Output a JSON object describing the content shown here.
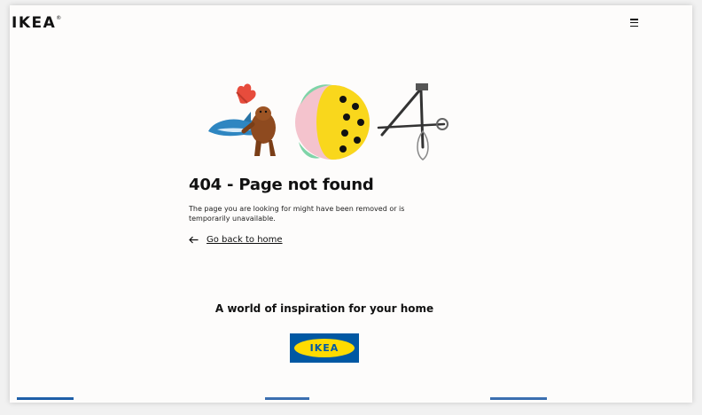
{
  "brand": {
    "name": "IKEA",
    "registered_mark": "®"
  },
  "header": {
    "menu_icon": "hamburger-menu-icon"
  },
  "error": {
    "title": "404 - Page not found",
    "description": "The page you are looking for might have been removed or is temporarily unavailable.",
    "back_link": "Go back to home",
    "back_icon": "arrow-left-icon"
  },
  "inspiration": {
    "heading": "A world of inspiration for your home",
    "logo_text": "IKEA"
  },
  "colors": {
    "ikea_blue": "#0058a3",
    "ikea_yellow": "#ffdb00"
  }
}
